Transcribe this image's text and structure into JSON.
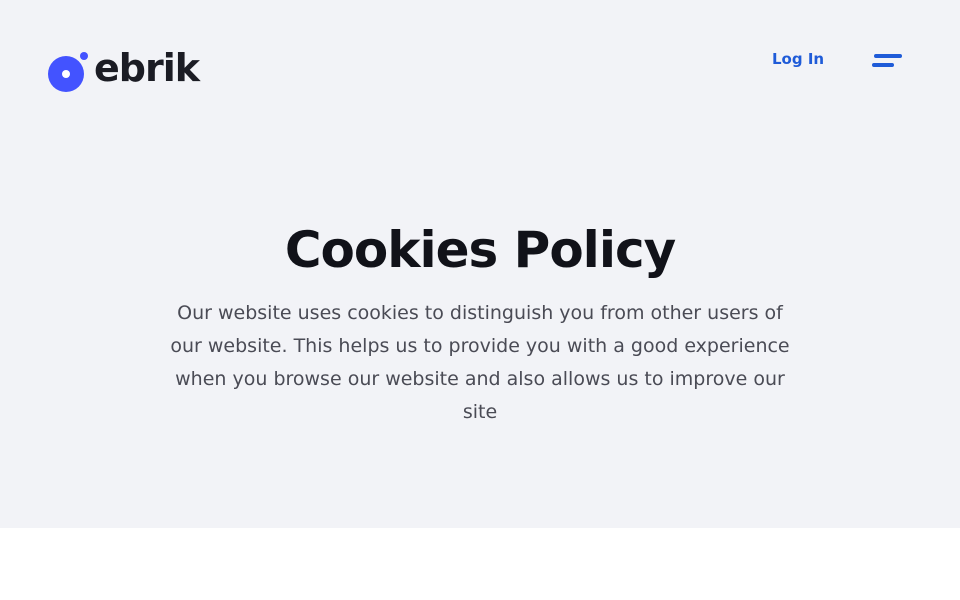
{
  "header": {
    "brand_name": "ebrik",
    "login_label": "Log In",
    "menu_icon": "hamburger-menu-icon",
    "logo_icon": "ebrik-logo-icon"
  },
  "hero": {
    "title": "Cookies Policy",
    "description": "Our website uses cookies to distinguish you from other users of our website. This helps us to provide you with a good experience when you browse our website and also allows us to improve our site"
  },
  "colors": {
    "brand_blue": "#4353ff",
    "link_blue": "#1f5bd8",
    "hero_background": "#f2f3f7",
    "title_text": "#111219",
    "body_text": "#4a4b55"
  }
}
